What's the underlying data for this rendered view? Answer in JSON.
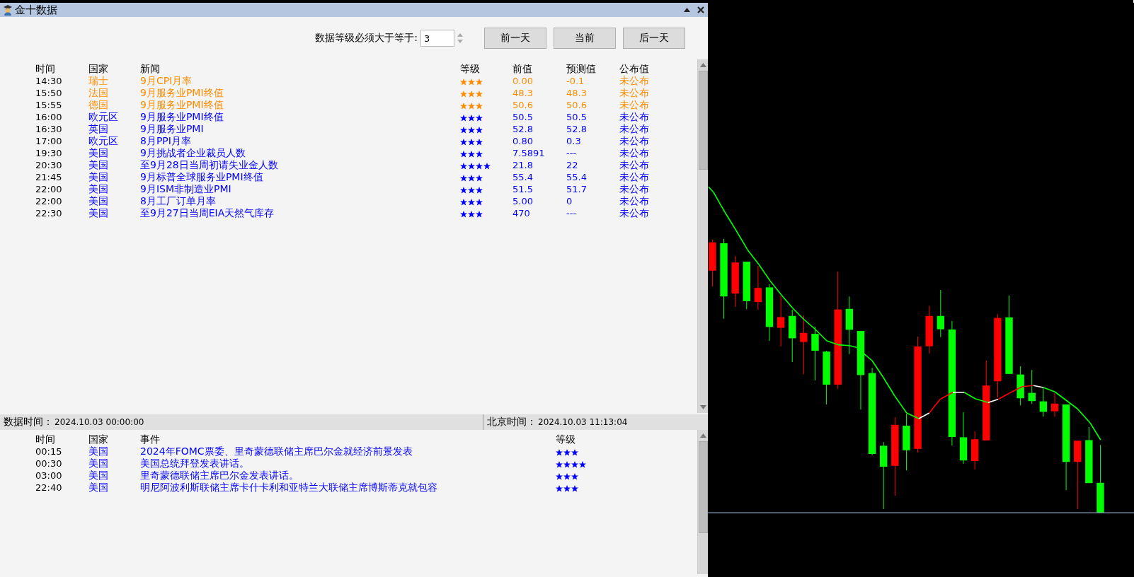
{
  "window": {
    "title": "金十数据"
  },
  "filter": {
    "label": "数据等级必须大于等于:",
    "value": "3"
  },
  "buttons": [
    "前一天",
    "当前",
    "后一天"
  ],
  "news_table": {
    "columns": [
      "时间",
      "国家",
      "新闻",
      "等级",
      "前值",
      "预测值",
      "公布值"
    ],
    "rows": [
      {
        "time": "14:30",
        "country": "瑞士",
        "news": "9月CPI月率",
        "stars": 3,
        "previous": "0.00",
        "forecast": "-0.1",
        "actual": "未公布",
        "color": "#ff8c00"
      },
      {
        "time": "15:50",
        "country": "法国",
        "news": "9月服务业PMI终值",
        "stars": 3,
        "previous": "48.3",
        "forecast": "48.3",
        "actual": "未公布",
        "color": "#ff8c00"
      },
      {
        "time": "15:55",
        "country": "德国",
        "news": "9月服务业PMI终值",
        "stars": 3,
        "previous": "50.6",
        "forecast": "50.6",
        "actual": "未公布",
        "color": "#ff8c00"
      },
      {
        "time": "16:00",
        "country": "欧元区",
        "news": "9月服务业PMI终值",
        "stars": 3,
        "previous": "50.5",
        "forecast": "50.5",
        "actual": "未公布",
        "color": "#0000ff"
      },
      {
        "time": "16:30",
        "country": "英国",
        "news": "9月服务业PMI",
        "stars": 3,
        "previous": "52.8",
        "forecast": "52.8",
        "actual": "未公布",
        "color": "#0000ff"
      },
      {
        "time": "17:00",
        "country": "欧元区",
        "news": "8月PPI月率",
        "stars": 3,
        "previous": "0.80",
        "forecast": "0.3",
        "actual": "未公布",
        "color": "#0000ff"
      },
      {
        "time": "19:30",
        "country": "美国",
        "news": "9月挑战者企业裁员人数",
        "stars": 3,
        "previous": "7.5891",
        "forecast": "---",
        "actual": "未公布",
        "color": "#0000ff"
      },
      {
        "time": "20:30",
        "country": "美国",
        "news": "至9月28日当周初请失业金人数",
        "stars": 4,
        "previous": "21.8",
        "forecast": "22",
        "actual": "未公布",
        "color": "#0000ff"
      },
      {
        "time": "21:45",
        "country": "美国",
        "news": "9月标普全球服务业PMI终值",
        "stars": 3,
        "previous": "55.4",
        "forecast": "55.4",
        "actual": "未公布",
        "color": "#0000ff"
      },
      {
        "time": "22:00",
        "country": "美国",
        "news": "9月ISM非制造业PMI",
        "stars": 3,
        "previous": "51.5",
        "forecast": "51.7",
        "actual": "未公布",
        "color": "#0000ff"
      },
      {
        "time": "22:00",
        "country": "美国",
        "news": "8月工厂订单月率",
        "stars": 3,
        "previous": "5.00",
        "forecast": "0",
        "actual": "未公布",
        "color": "#0000ff"
      },
      {
        "time": "22:30",
        "country": "美国",
        "news": "至9月27日当周EIA天然气库存",
        "stars": 3,
        "previous": "470",
        "forecast": "---",
        "actual": "未公布",
        "color": "#0000ff"
      }
    ]
  },
  "status_bar": {
    "data_time_label": "数据时间：",
    "data_time": "2024.10.03 00:00:00",
    "beijing_time_label": "北京时间：",
    "beijing_time": "2024.10.03 11:13:04"
  },
  "events_table": {
    "columns": [
      "时间",
      "国家",
      "事件",
      "等级"
    ],
    "rows": [
      {
        "time": "00:15",
        "country": "美国",
        "event": "2024年FOMC票委、里奇蒙德联储主席巴尔金就经济前景发表",
        "stars": 3,
        "color": "#0000ff"
      },
      {
        "time": "00:30",
        "country": "美国",
        "event": "美国总统拜登发表讲话。",
        "stars": 4,
        "color": "#0000ff"
      },
      {
        "time": "03:00",
        "country": "美国",
        "event": "里奇蒙德联储主席巴尔金发表讲话。",
        "stars": 3,
        "color": "#0000ff"
      },
      {
        "time": "22:40",
        "country": "美国",
        "event": "明尼阿波利斯联储主席卡什卡利和亚特兰大联储主席博斯蒂克就包容",
        "stars": 3,
        "color": "#0000ff"
      }
    ]
  }
}
